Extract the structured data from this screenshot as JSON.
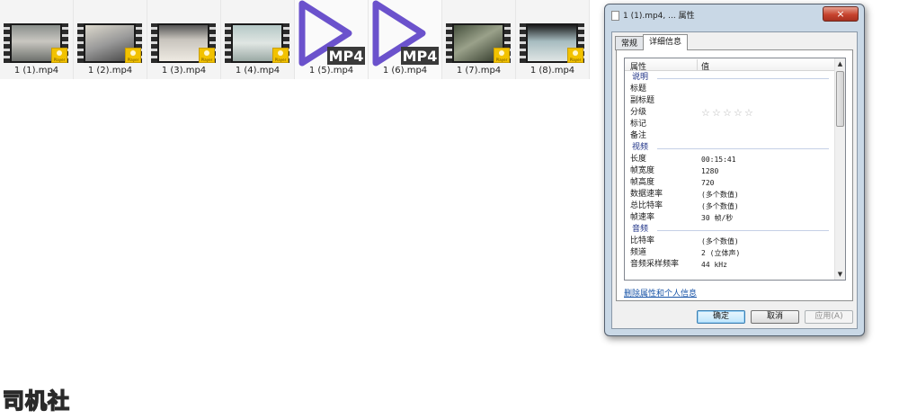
{
  "files": [
    {
      "label": "1 (1).mp4",
      "type": "video-thumb",
      "badge": "player-badge"
    },
    {
      "label": "1 (2).mp4",
      "type": "video-thumb",
      "badge": "player-badge"
    },
    {
      "label": "1 (3).mp4",
      "type": "video-thumb",
      "badge": "player-badge"
    },
    {
      "label": "1 (4).mp4",
      "type": "video-thumb",
      "badge": "player-badge"
    },
    {
      "label": "1 (5).mp4",
      "type": "mp4-icon",
      "icon_text": "MP4"
    },
    {
      "label": "1 (6).mp4",
      "type": "mp4-icon",
      "icon_text": "MP4"
    },
    {
      "label": "1 (7).mp4",
      "type": "video-thumb",
      "badge": "player-badge"
    },
    {
      "label": "1 (8).mp4",
      "type": "video-thumb",
      "badge": "player-badge"
    }
  ],
  "dialog": {
    "title": "1 (1).mp4, ... 属性",
    "close_icon": "×",
    "tabs": [
      {
        "label": "常规",
        "active": false
      },
      {
        "label": "详细信息",
        "active": true
      }
    ],
    "table_header": {
      "property": "属性",
      "value": "值"
    },
    "groups": {
      "description": {
        "title": "说明",
        "rows": {
          "title": "标题",
          "subtitle": "副标题",
          "rating": "分级",
          "tags": "标记",
          "comments": "备注"
        },
        "rating_stars": 5,
        "rating_value": 0
      },
      "video": {
        "title": "视频",
        "rows": [
          {
            "key": "长度",
            "value": "00:15:41"
          },
          {
            "key": "帧宽度",
            "value": "1280"
          },
          {
            "key": "帧高度",
            "value": "720"
          },
          {
            "key": "数据速率",
            "value": "(多个数值)"
          },
          {
            "key": "总比特率",
            "value": "(多个数值)"
          },
          {
            "key": "帧速率",
            "value": "30 帧/秒"
          }
        ]
      },
      "audio": {
        "title": "音频",
        "rows": [
          {
            "key": "比特率",
            "value": "(多个数值)"
          },
          {
            "key": "频道",
            "value": "2 (立体声)"
          },
          {
            "key": "音频采样频率",
            "value": "44 kHz"
          }
        ]
      }
    },
    "remove_link": "删除属性和个人信息",
    "buttons": {
      "ok": "确定",
      "cancel": "取消",
      "apply": "应用(A)"
    }
  },
  "watermark": "司机社",
  "colors": {
    "accent_play": "#6b52cc",
    "link": "#1a55a8",
    "close": "#c7442e",
    "badge": "#f2c200"
  }
}
